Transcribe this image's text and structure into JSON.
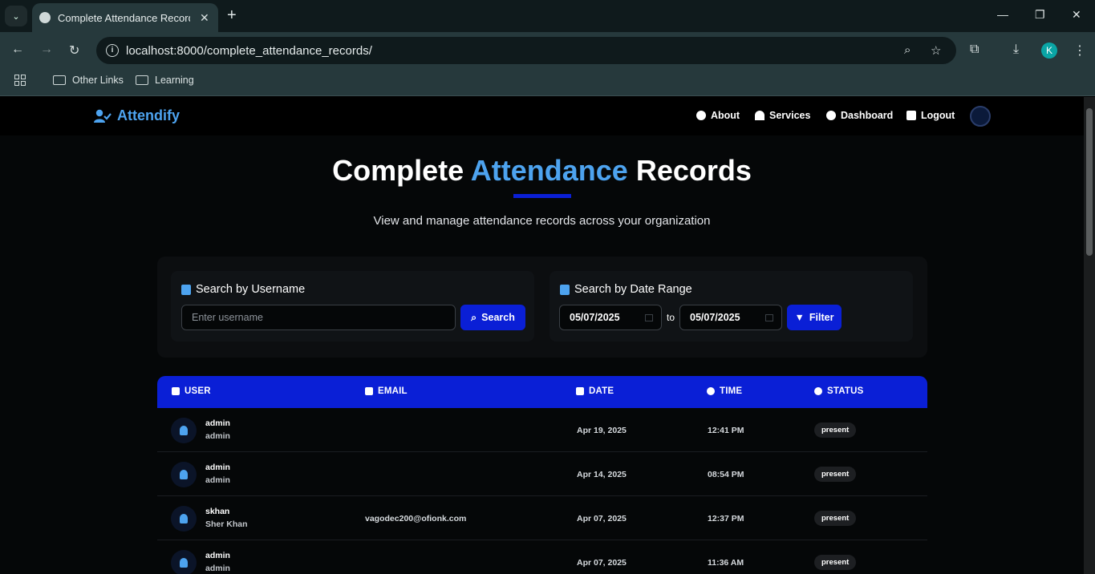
{
  "browser": {
    "tab_title": "Complete Attendance Records",
    "url_host": "localhost",
    "url_path": ":8000/complete_attendance_records/",
    "profile_initial": "K",
    "bookmarks": [
      "Other Links",
      "Learning"
    ]
  },
  "navbar": {
    "brand": "Attendify",
    "links": [
      "About",
      "Services",
      "Dashboard",
      "Logout"
    ]
  },
  "hero": {
    "title_start": "Complete ",
    "title_accent": "Attendance",
    "title_end": " Records",
    "subtitle": "View and manage attendance records across your organization"
  },
  "filters": {
    "username_label": "Search by Username",
    "username_placeholder": "Enter username",
    "search_button": "Search",
    "date_label": "Search by Date Range",
    "date_from": "05/07/2025",
    "date_to": "05/07/2025",
    "to_text": "to",
    "filter_button": "Filter"
  },
  "table": {
    "headers": [
      "USER",
      "EMAIL",
      "DATE",
      "TIME",
      "STATUS"
    ],
    "rows": [
      {
        "username": "admin",
        "full_name": "admin",
        "email": "",
        "date": "Apr 19, 2025",
        "time": "12:41 PM",
        "status": "present"
      },
      {
        "username": "admin",
        "full_name": "admin",
        "email": "",
        "date": "Apr 14, 2025",
        "time": "08:54 PM",
        "status": "present"
      },
      {
        "username": "skhan",
        "full_name": "Sher Khan",
        "email": "vagodec200@ofionk.com",
        "date": "Apr 07, 2025",
        "time": "12:37 PM",
        "status": "present"
      },
      {
        "username": "admin",
        "full_name": "admin",
        "email": "",
        "date": "Apr 07, 2025",
        "time": "11:36 AM",
        "status": "present"
      }
    ]
  },
  "colors": {
    "accent": "#4da3ef",
    "primary": "#0a1fd6",
    "background": "#050708"
  }
}
